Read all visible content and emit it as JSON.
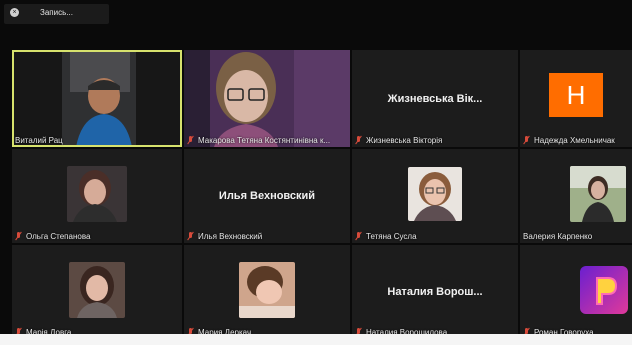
{
  "recording": {
    "label": "Запись..."
  },
  "avatar_letter": "H",
  "tiles": [
    {
      "name": "Виталий Рац",
      "muted": false
    },
    {
      "name": "Макарова Тетяна Костянтинівна к...",
      "muted": true
    },
    {
      "name": "Жизневська Вікторія",
      "muted": true,
      "display": "Жизневська Вік..."
    },
    {
      "name": "Надежда Хмельничак",
      "muted": true
    },
    {
      "name": "Ольга Степанова",
      "muted": true
    },
    {
      "name": "Илья Вехновский",
      "muted": true,
      "display": "Илья Вехновский"
    },
    {
      "name": "Тетяна Сусла",
      "muted": true
    },
    {
      "name": "Валерия Карпенко",
      "muted": false
    },
    {
      "name": "Марія Довга",
      "muted": true
    },
    {
      "name": "Мария Деркач",
      "muted": true
    },
    {
      "name": "Наталия Ворошилова",
      "muted": true,
      "display": "Наталия Ворош..."
    },
    {
      "name": "Роман Говоруха",
      "muted": true
    }
  ]
}
